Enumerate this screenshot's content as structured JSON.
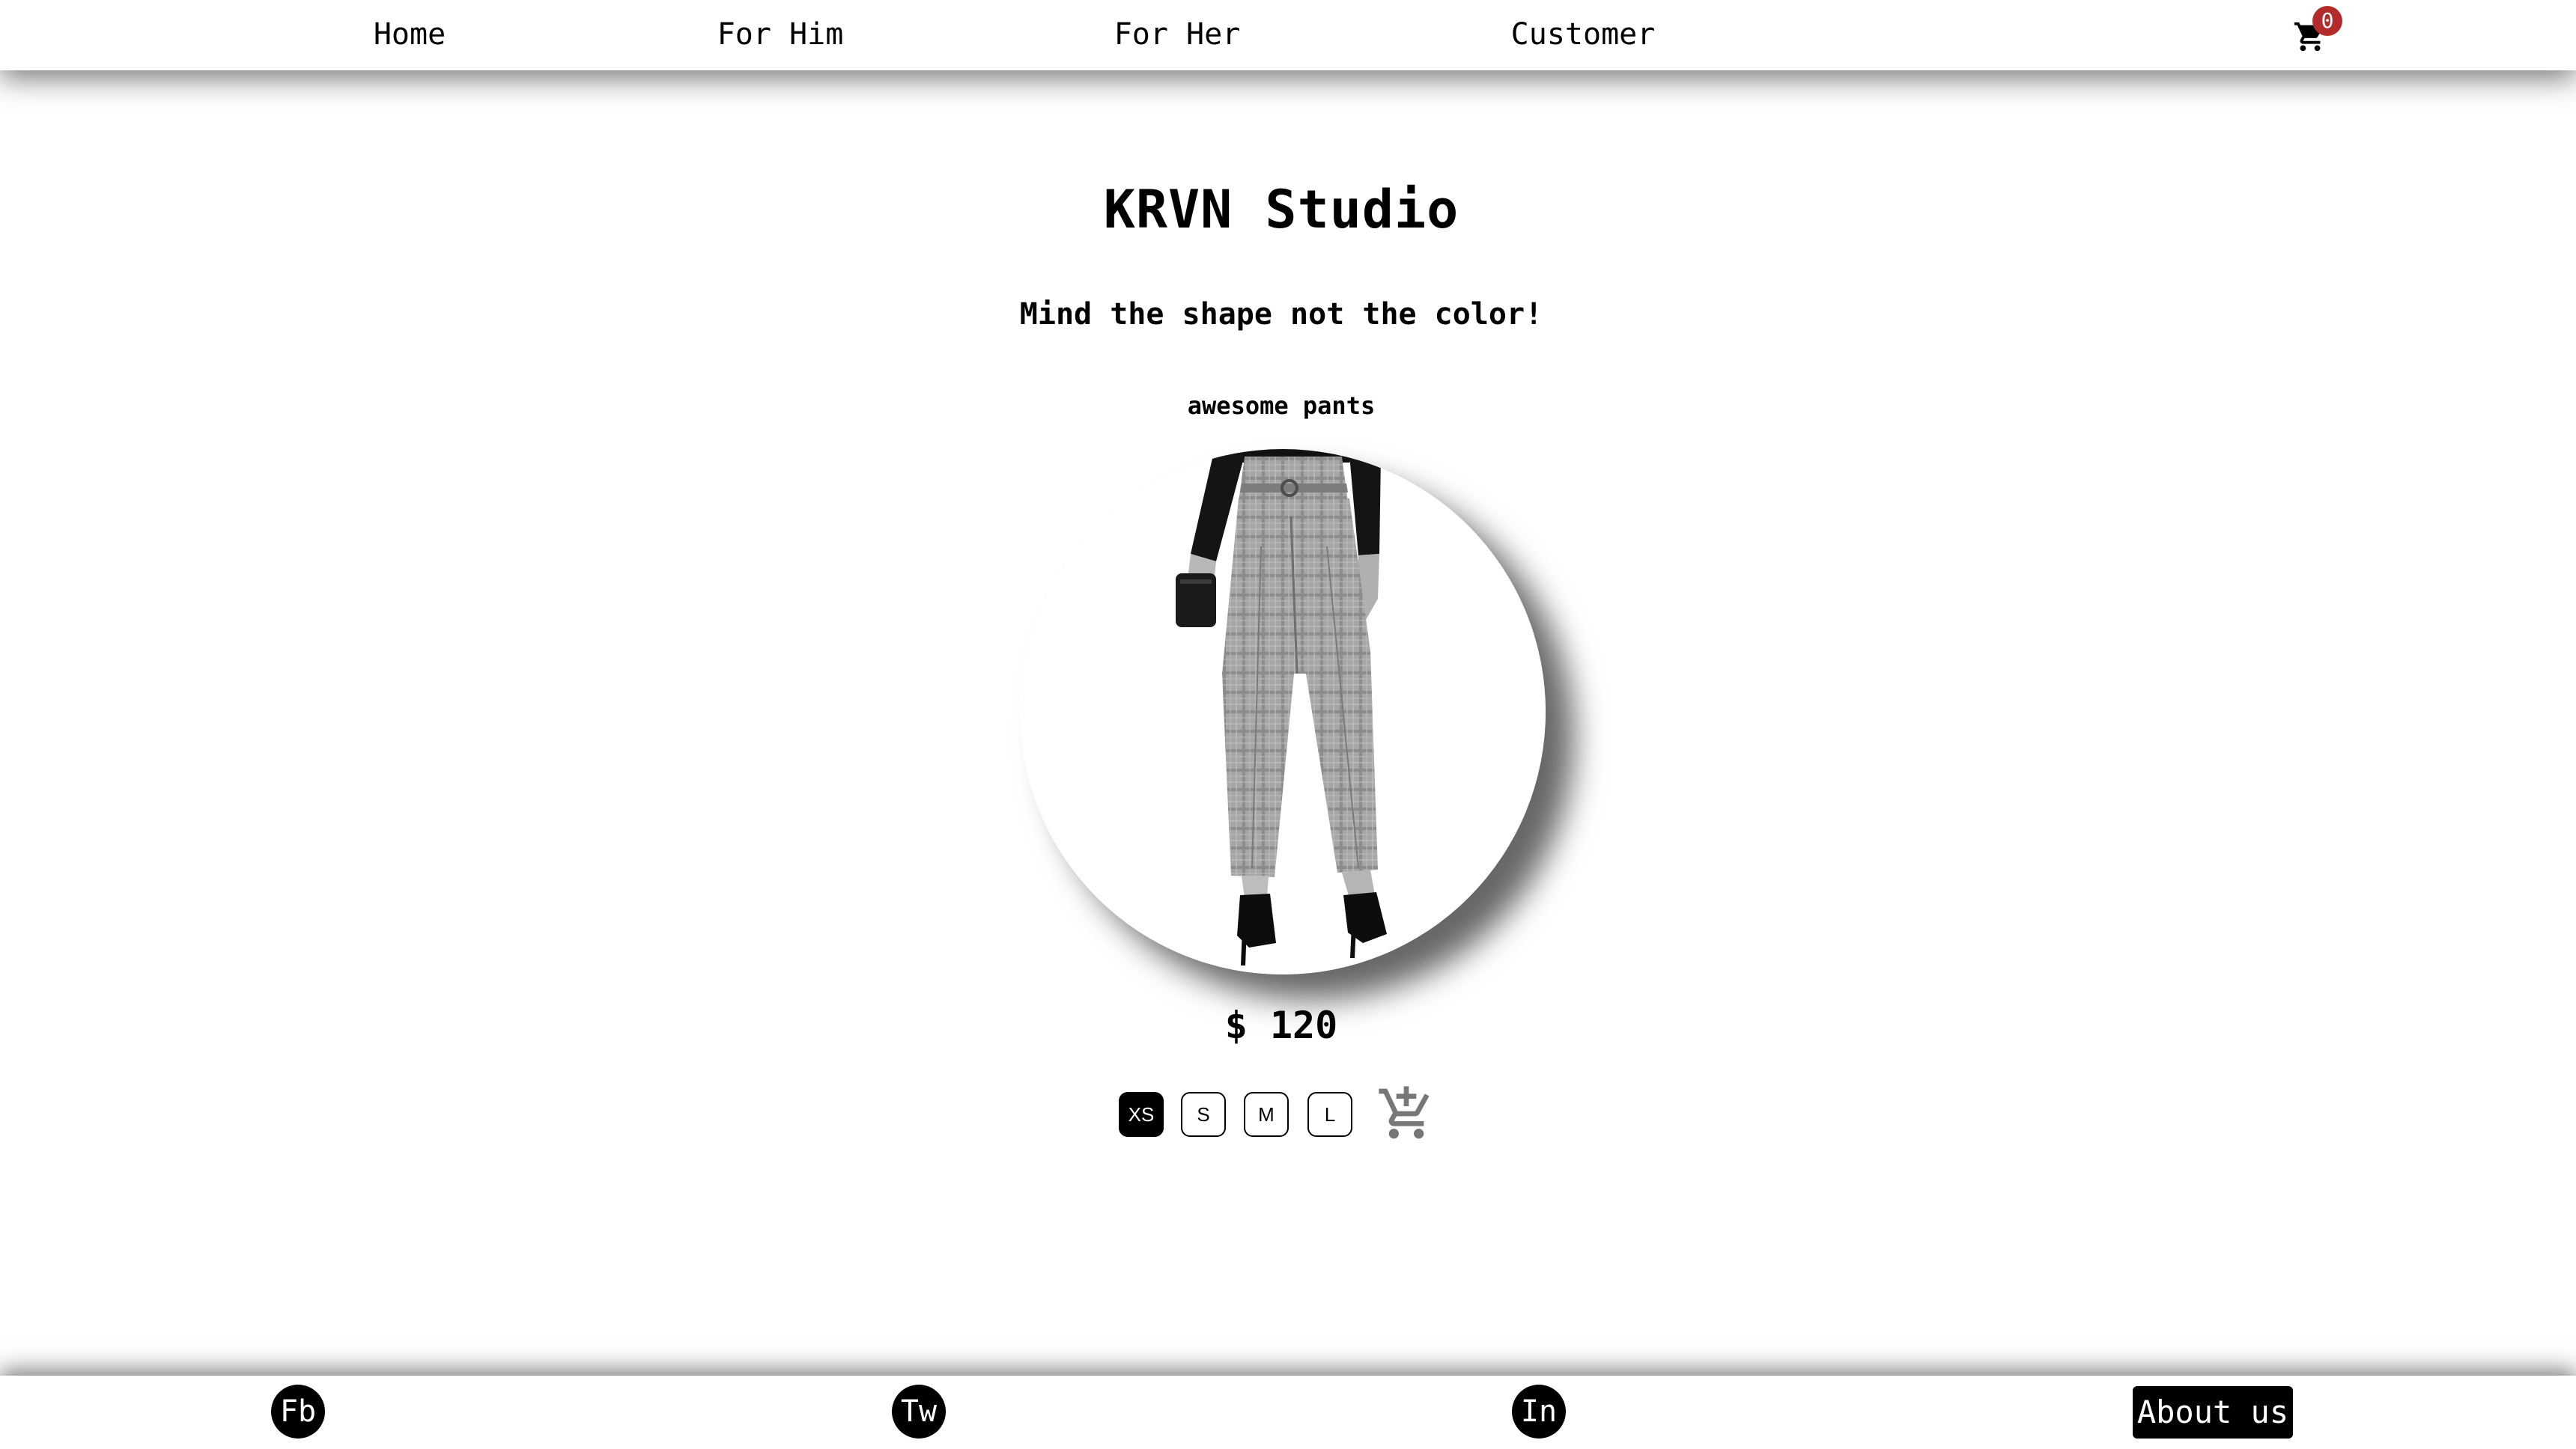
{
  "nav": {
    "items": [
      {
        "label": "Home"
      },
      {
        "label": "For Him"
      },
      {
        "label": "For Her"
      },
      {
        "label": "Customer"
      }
    ],
    "cart": {
      "icon": "cart-icon",
      "count": "0",
      "badge_color": "#b22c2c"
    }
  },
  "main": {
    "title": "KRVN Studio",
    "tagline": "Mind the shape not the color!",
    "product": {
      "name": "awesome pants",
      "image_icon": "plaid-pants-photo",
      "price": "$ 120",
      "sizes": [
        {
          "label": "XS",
          "selected": true
        },
        {
          "label": "S",
          "selected": false
        },
        {
          "label": "M",
          "selected": false
        },
        {
          "label": "L",
          "selected": false
        }
      ],
      "add_to_cart_icon": "cart-add-icon"
    }
  },
  "footer": {
    "social": [
      {
        "label": "Fb"
      },
      {
        "label": "Tw"
      },
      {
        "label": "In"
      }
    ],
    "about_label": "About us"
  },
  "colors": {
    "background": "#ffffff",
    "text": "#000000",
    "accent_badge": "#b22c2c",
    "add_cart_icon": "#777777"
  }
}
